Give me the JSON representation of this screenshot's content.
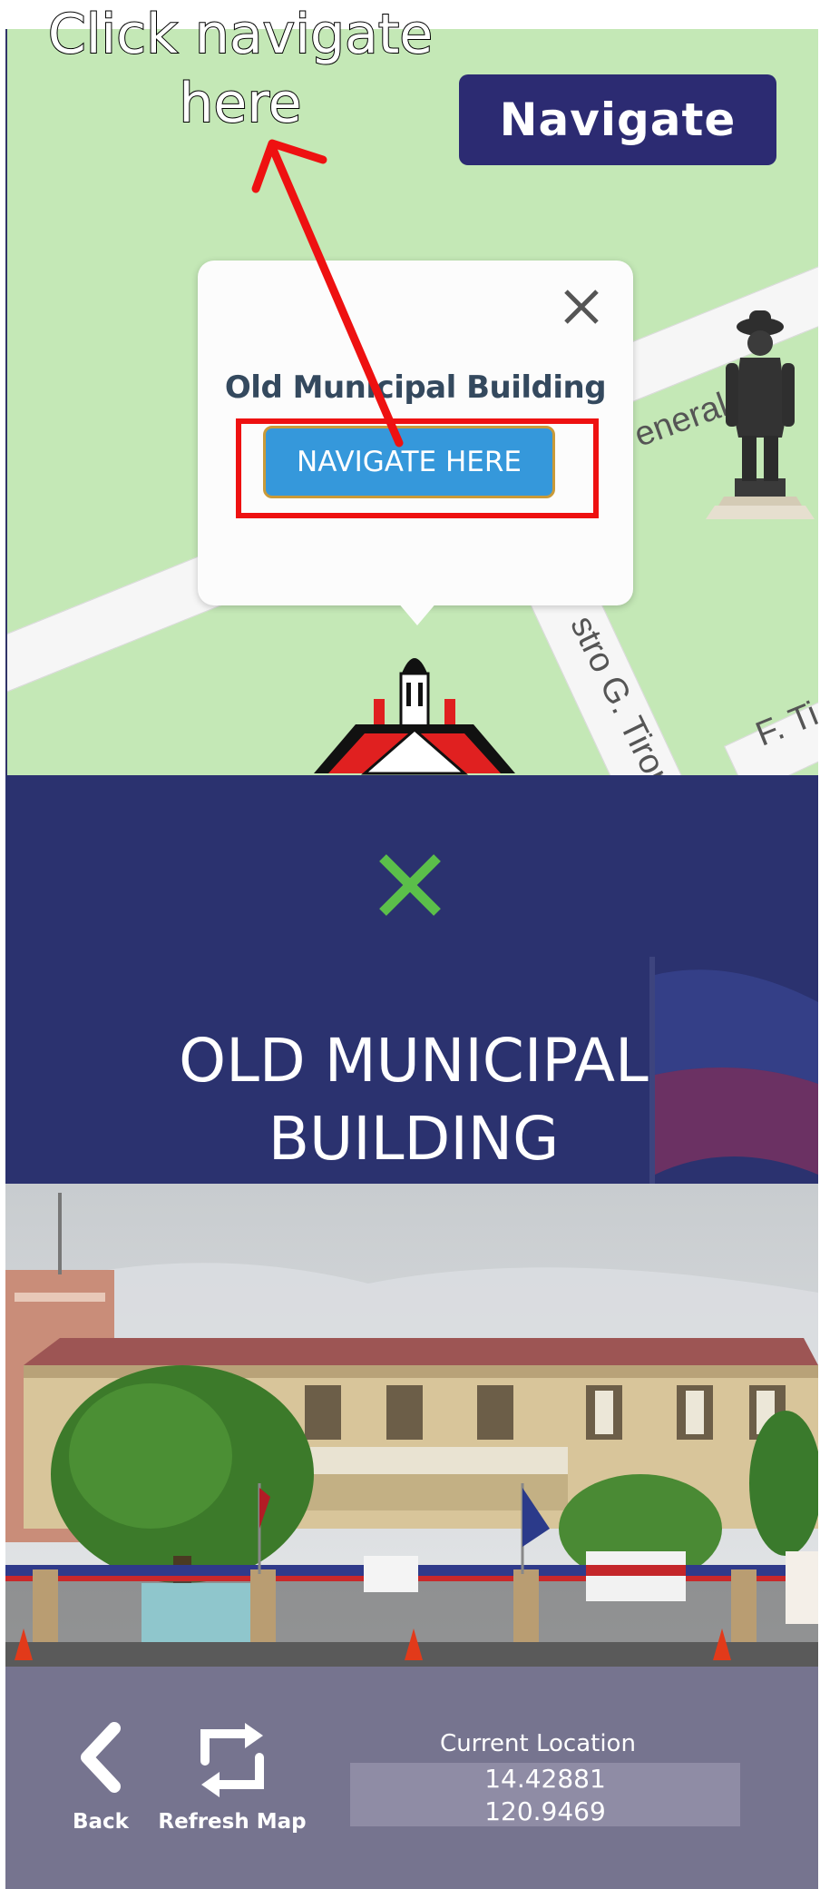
{
  "annotation": {
    "line1": "Click  navigate",
    "line2": "here"
  },
  "map": {
    "navigate_button_label": "Navigate",
    "road_labels": [
      "eneral",
      "stro G. Tirona",
      "F. Ti"
    ],
    "popup": {
      "title": "Old Municipal Building",
      "button_label": "NAVIGATE HERE"
    }
  },
  "place": {
    "title": "OLD MUNICIPAL BUILDING"
  },
  "bottom_bar": {
    "back_label": "Back",
    "refresh_label": "Refresh Map",
    "location_title": "Current Location",
    "latitude": "14.42881",
    "longitude": "120.9469"
  },
  "colors": {
    "map_green": "#c4e8b6",
    "navy": "#2c2b72",
    "popup_button": "#3598db",
    "highlight_red": "#ee1111",
    "banner_x_green": "#5bbf4a",
    "bottom_bar": "#76748f"
  },
  "icons": [
    "close-icon",
    "arrow-annotation",
    "statue-icon",
    "municipal-building-icon",
    "close-x-icon",
    "back-chevron-icon",
    "refresh-icon"
  ]
}
